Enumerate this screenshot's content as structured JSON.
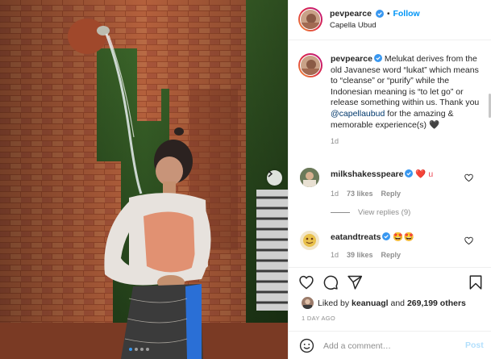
{
  "post": {
    "author": "pevpearce",
    "follow_separator": "•",
    "follow_label": "Follow",
    "location": "Capella Ubud"
  },
  "caption": {
    "author": "pevpearce",
    "text_part1": "Melukat derives from the old Javanese word “lukat” which means to “cleanse” or “purify” while the Indonesian meaning is “to let go” or release something within us. Thank you ",
    "mention": "@capellaubud",
    "text_part2": " for the amazing & memorable experience(s) ",
    "emoji": "🖤",
    "age": "1d"
  },
  "comments": [
    {
      "author": "milkshakesspeare",
      "text": "❤️ u",
      "age": "1d",
      "likes": "73 likes",
      "reply_label": "Reply",
      "view_replies": "View replies (9)"
    },
    {
      "author": "eatandtreats",
      "text": "🤩🤩",
      "age": "1d",
      "likes": "39 likes",
      "reply_label": "Reply"
    }
  ],
  "likes": {
    "prefix": "Liked by",
    "user": "keanuagl",
    "middle": "and",
    "count": "269,199 others"
  },
  "posted_ago": "1 DAY AGO",
  "composer": {
    "placeholder": "Add a comment…",
    "post_label": "Post"
  },
  "carousel": {
    "slide_count": 4,
    "active_index": 0
  },
  "colors": {
    "accent": "#0095f6",
    "mention": "#00376b",
    "muted": "#8e8e8e",
    "post_disabled": "#b2dffc"
  },
  "icons": {
    "verified": "verified-badge-icon",
    "like": "heart-icon",
    "comment": "comment-bubble-icon",
    "share": "paper-plane-icon",
    "save": "bookmark-icon",
    "emoji": "smiley-icon",
    "next": "chevron-right-icon"
  }
}
